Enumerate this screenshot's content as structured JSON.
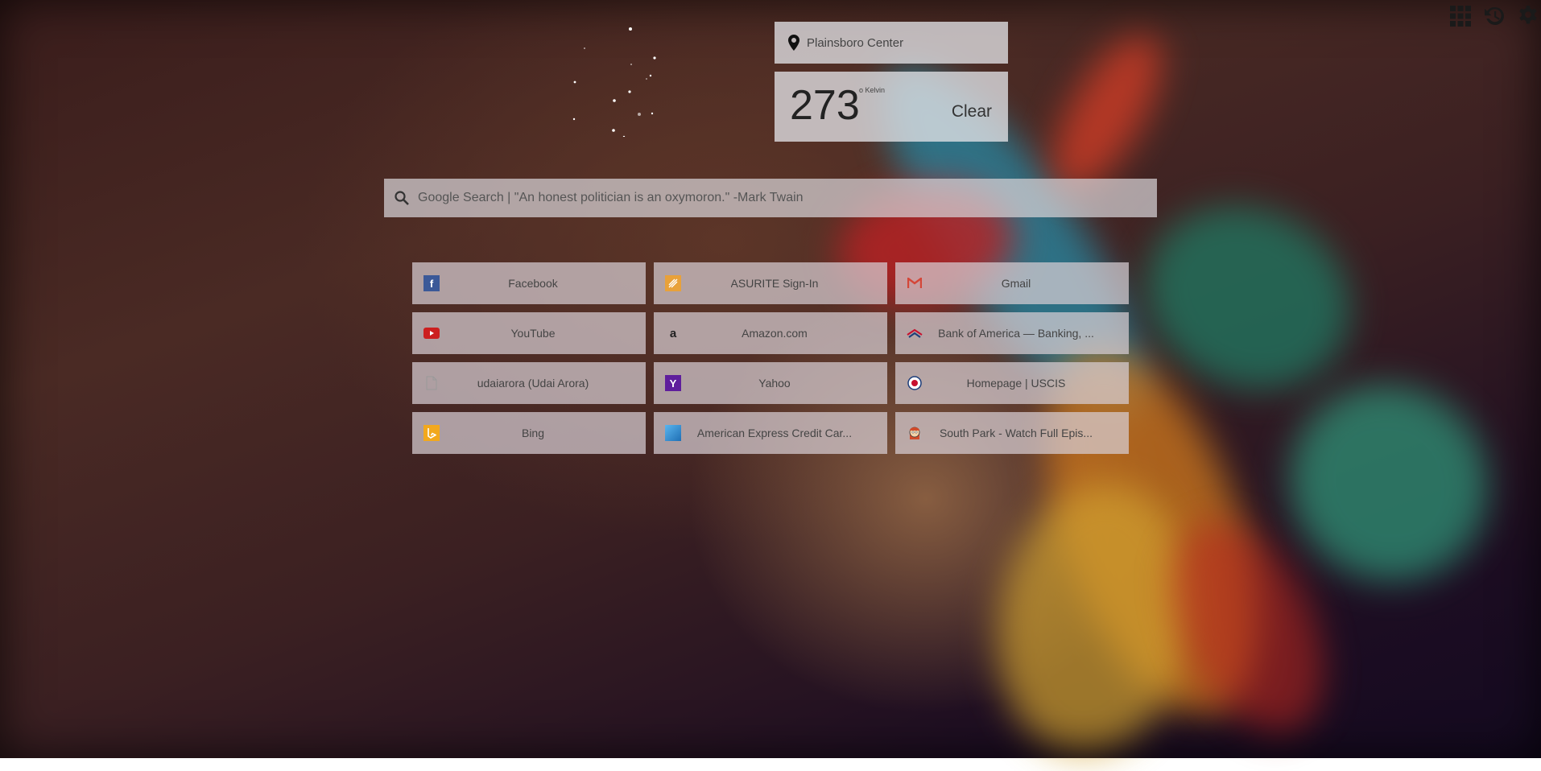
{
  "location": {
    "name": "Plainsboro Center"
  },
  "weather": {
    "temperature": "273",
    "unit": "o Kelvin",
    "condition": "Clear"
  },
  "search": {
    "placeholder": "Google Search | \"An honest politician is an oxymoron.\" -Mark Twain"
  },
  "top_icons": [
    "apps-grid-icon",
    "history-icon",
    "settings-gear-icon"
  ],
  "tiles": [
    {
      "label": "Facebook",
      "icon": "facebook-icon",
      "color": "#3b5998"
    },
    {
      "label": "ASURITE Sign-In",
      "icon": "asu-icon",
      "color": "#e8a13a"
    },
    {
      "label": "Gmail",
      "icon": "gmail-icon",
      "color": "#d44638"
    },
    {
      "label": "YouTube",
      "icon": "youtube-icon",
      "color": "#cc1f1f"
    },
    {
      "label": "Amazon.com",
      "icon": "amazon-icon",
      "color": "#222222"
    },
    {
      "label": "Bank of America — Banking, ...",
      "icon": "bank-of-america-icon",
      "color": "#c8102e"
    },
    {
      "label": "udaiarora (Udai Arora)",
      "icon": "page-icon",
      "color": "#999999"
    },
    {
      "label": "Yahoo",
      "icon": "yahoo-icon",
      "color": "#5f1e9c"
    },
    {
      "label": "Homepage | USCIS",
      "icon": "uscis-icon",
      "color": "#1d3d7a"
    },
    {
      "label": "Bing",
      "icon": "bing-icon",
      "color": "#f2a81d"
    },
    {
      "label": "American Express Credit Car...",
      "icon": "amex-icon",
      "color": "#2a8bd3"
    },
    {
      "label": "South Park - Watch Full Epis...",
      "icon": "south-park-icon",
      "color": "#d24b2a"
    }
  ]
}
